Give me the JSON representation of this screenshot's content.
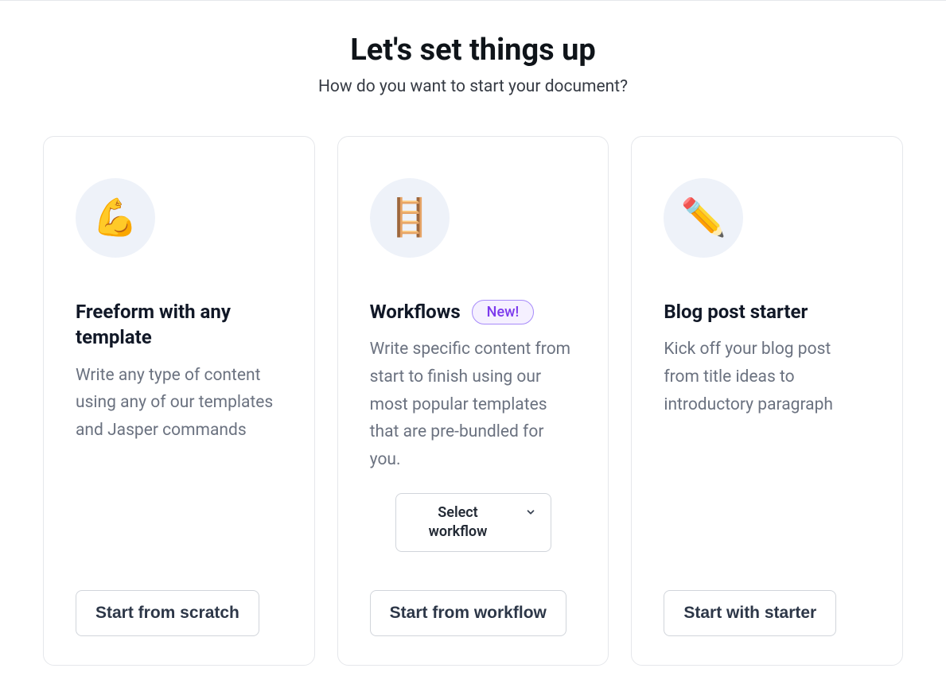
{
  "header": {
    "title": "Let's set things up",
    "subtitle": "How do you want to start your document?"
  },
  "cards": {
    "freeform": {
      "icon": "💪",
      "title": "Freeform with any template",
      "description": "Write any type of content using any of our templates and Jasper commands",
      "button": "Start from scratch"
    },
    "workflows": {
      "icon": "🪜",
      "title": "Workflows",
      "badge": "New!",
      "description": "Write specific content from start to finish using our most popular templates that are pre-bundled for you.",
      "select_label": "Select workflow",
      "button": "Start from workflow"
    },
    "blog": {
      "icon": "✏️",
      "title": "Blog post starter",
      "description": "Kick off your blog post from title ideas to introductory paragraph",
      "button": "Start with starter"
    }
  }
}
